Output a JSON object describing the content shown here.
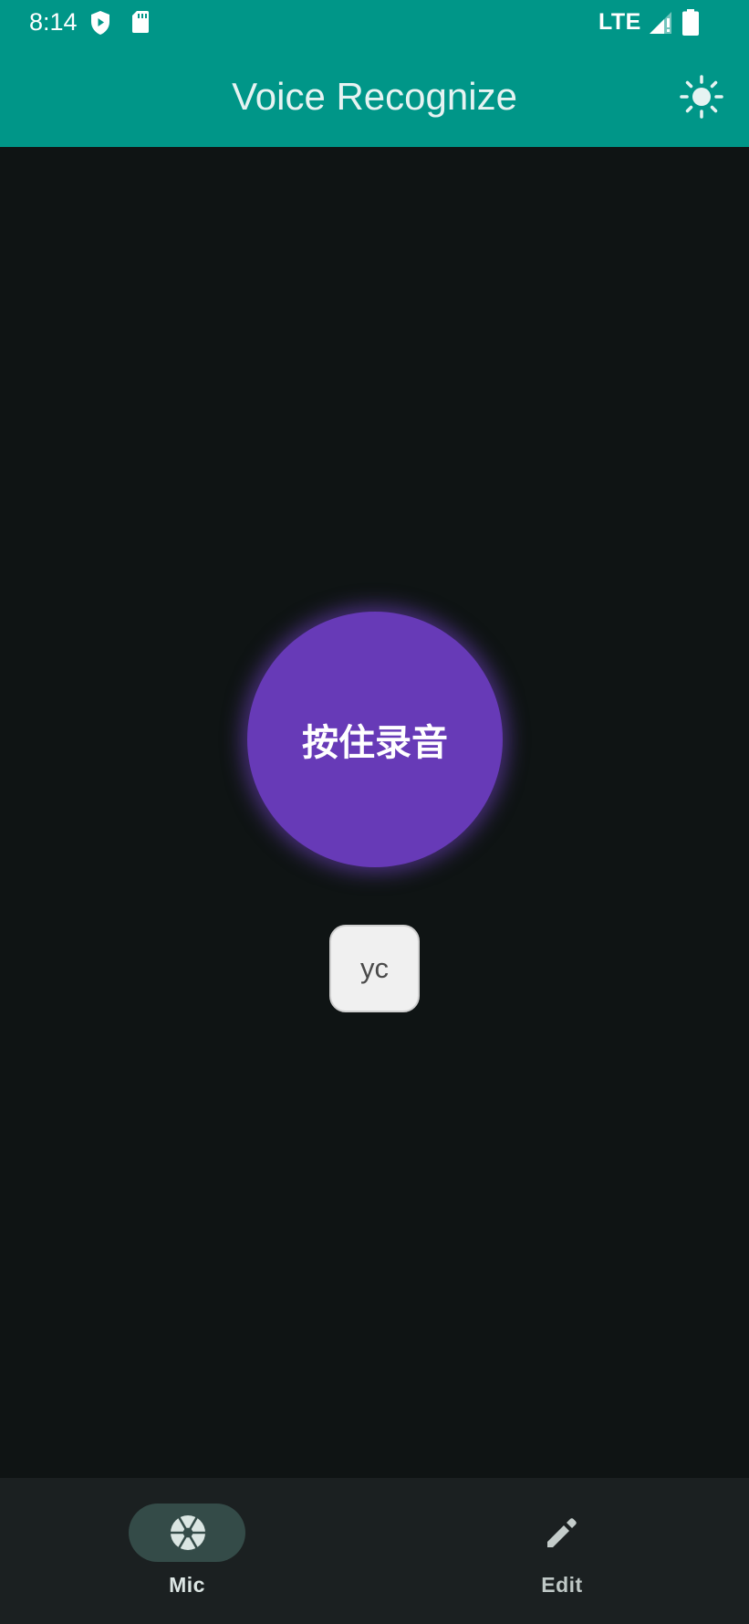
{
  "status_bar": {
    "time": "8:14",
    "network": "LTE",
    "icons": [
      "shield-play-icon",
      "sd-card-icon",
      "signal-icon",
      "battery-icon"
    ]
  },
  "app_bar": {
    "title": "Voice Recognize",
    "action_icon": "brightness-icon",
    "background": "#009688"
  },
  "main": {
    "record_button_label": "按住录音",
    "record_button_color": "#673ab7",
    "chip_label": "yc",
    "background": "#0f1414"
  },
  "bottom_nav": {
    "items": [
      {
        "label": "Mic",
        "icon": "camera-aperture-icon",
        "selected": true
      },
      {
        "label": "Edit",
        "icon": "pencil-icon",
        "selected": false
      }
    ],
    "background": "#1b2021",
    "indicator_color": "#344b48"
  }
}
